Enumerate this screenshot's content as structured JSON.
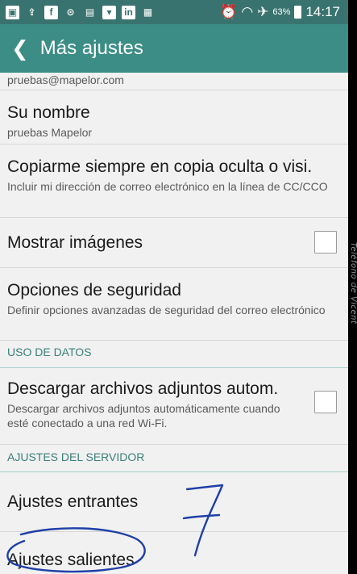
{
  "status_bar": {
    "battery": "63%",
    "time": "14:17",
    "icons": [
      "notification-icon",
      "upload-icon",
      "facebook-icon",
      "alarm-icon",
      "gallery-icon",
      "messages-icon",
      "linkedin-icon",
      "calendar-icon",
      "alarm-clock-icon",
      "wifi-icon",
      "airplane-icon",
      "battery-icon"
    ]
  },
  "header": {
    "title": "Más ajustes"
  },
  "account": {
    "email": "pruebas@mapelor.com"
  },
  "settings": {
    "name_label": "Su nombre",
    "name_value": "pruebas Mapelor",
    "bcc_label": "Copiarme siempre en copia oculta o visi.",
    "bcc_desc": "Incluir mi dirección de correo electrónico en la línea de CC/CCO",
    "images_label": "Mostrar imágenes",
    "images_checked": false,
    "security_label": "Opciones de seguridad",
    "security_desc": "Definir opciones avanzadas de seguridad del correo electrónico"
  },
  "data_usage": {
    "section_title": "USO DE DATOS",
    "attach_label": "Descargar archivos adjuntos autom.",
    "attach_desc": "Descargar archivos adjuntos automáticamente cuando esté conectado a una red Wi-Fi.",
    "attach_checked": false
  },
  "server": {
    "section_title": "AJUSTES DEL SERVIDOR",
    "incoming_label": "Ajustes entrantes",
    "outgoing_label": "Ajustes salientes"
  },
  "side_watermark": "Teléfono de Vicent",
  "annotation": {
    "handwritten_number": "7",
    "ink_color": "#1f3fa8"
  }
}
